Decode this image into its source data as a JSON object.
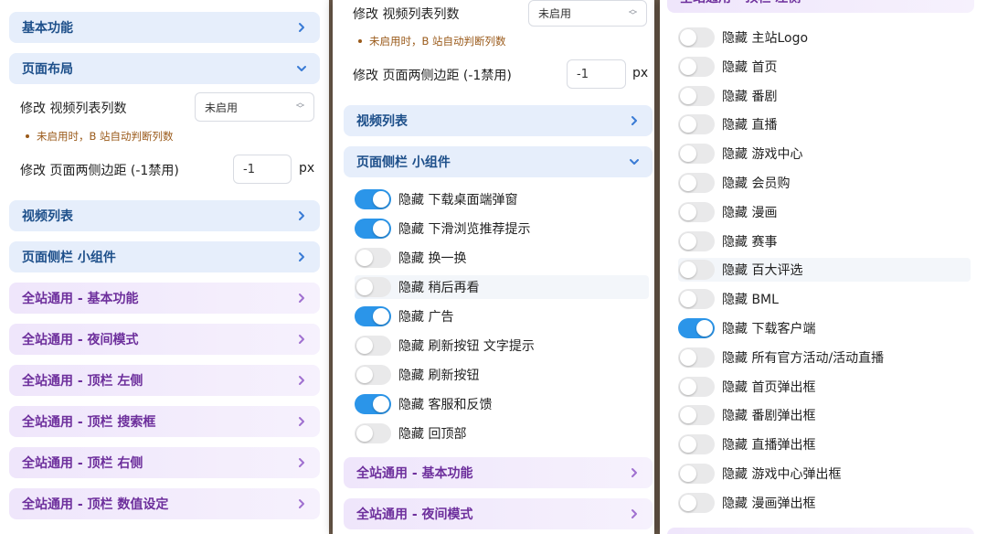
{
  "common": {
    "page_layout": "页面布局",
    "basic_functions": "基本功能",
    "modify_columns_label": "修改 视频列表列数",
    "select_value": "未启用",
    "hint": "未启用时，B 站自动判断列数",
    "modify_margin_label": "修改 页面两侧边距 (-1禁用)",
    "margin_value": "-1",
    "unit": "px",
    "video_list": "视频列表",
    "sidebar_widgets": "页面侧栏 小组件",
    "global_basic": "全站通用 - 基本功能",
    "global_night": "全站通用 - 夜间模式",
    "global_topbar_left": "全站通用 - 顶栏 左侧",
    "global_topbar_search": "全站通用 - 顶栏 搜索框",
    "global_topbar_right": "全站通用 - 顶栏 右侧",
    "global_topbar_values": "全站通用 - 顶栏 数值设定"
  },
  "panel2": {
    "toggles": [
      {
        "label": "隐藏 下载桌面端弹窗",
        "on": true
      },
      {
        "label": "隐藏 下滑浏览推荐提示",
        "on": true
      },
      {
        "label": "隐藏 换一换",
        "on": false
      },
      {
        "label": "隐藏 稍后再看",
        "on": false
      },
      {
        "label": "隐藏 广告",
        "on": true
      },
      {
        "label": "隐藏 刷新按钮 文字提示",
        "on": false
      },
      {
        "label": "隐藏 刷新按钮",
        "on": false
      },
      {
        "label": "隐藏 客服和反馈",
        "on": true
      },
      {
        "label": "隐藏 回顶部",
        "on": false
      }
    ]
  },
  "panel3": {
    "toggles": [
      {
        "label": "隐藏 主站Logo",
        "on": false
      },
      {
        "label": "隐藏 首页",
        "on": false
      },
      {
        "label": "隐藏 番剧",
        "on": false
      },
      {
        "label": "隐藏 直播",
        "on": false
      },
      {
        "label": "隐藏 游戏中心",
        "on": false
      },
      {
        "label": "隐藏 会员购",
        "on": false
      },
      {
        "label": "隐藏 漫画",
        "on": false
      },
      {
        "label": "隐藏 赛事",
        "on": false
      },
      {
        "label": "隐藏 百大评选",
        "on": false
      },
      {
        "label": "隐藏 BML",
        "on": false
      },
      {
        "label": "隐藏 下载客户端",
        "on": true
      },
      {
        "label": "隐藏 所有官方活动/活动直播",
        "on": false
      },
      {
        "label": "隐藏 首页弹出框",
        "on": false
      },
      {
        "label": "隐藏 番剧弹出框",
        "on": false
      },
      {
        "label": "隐藏 直播弹出框",
        "on": false
      },
      {
        "label": "隐藏 游戏中心弹出框",
        "on": false
      },
      {
        "label": "隐藏 漫画弹出框",
        "on": false
      }
    ]
  },
  "colors": {
    "accent_blue": "#2b95e9",
    "header_blue_text": "#1d4f8a",
    "header_purple_text": "#6d2f9c"
  }
}
